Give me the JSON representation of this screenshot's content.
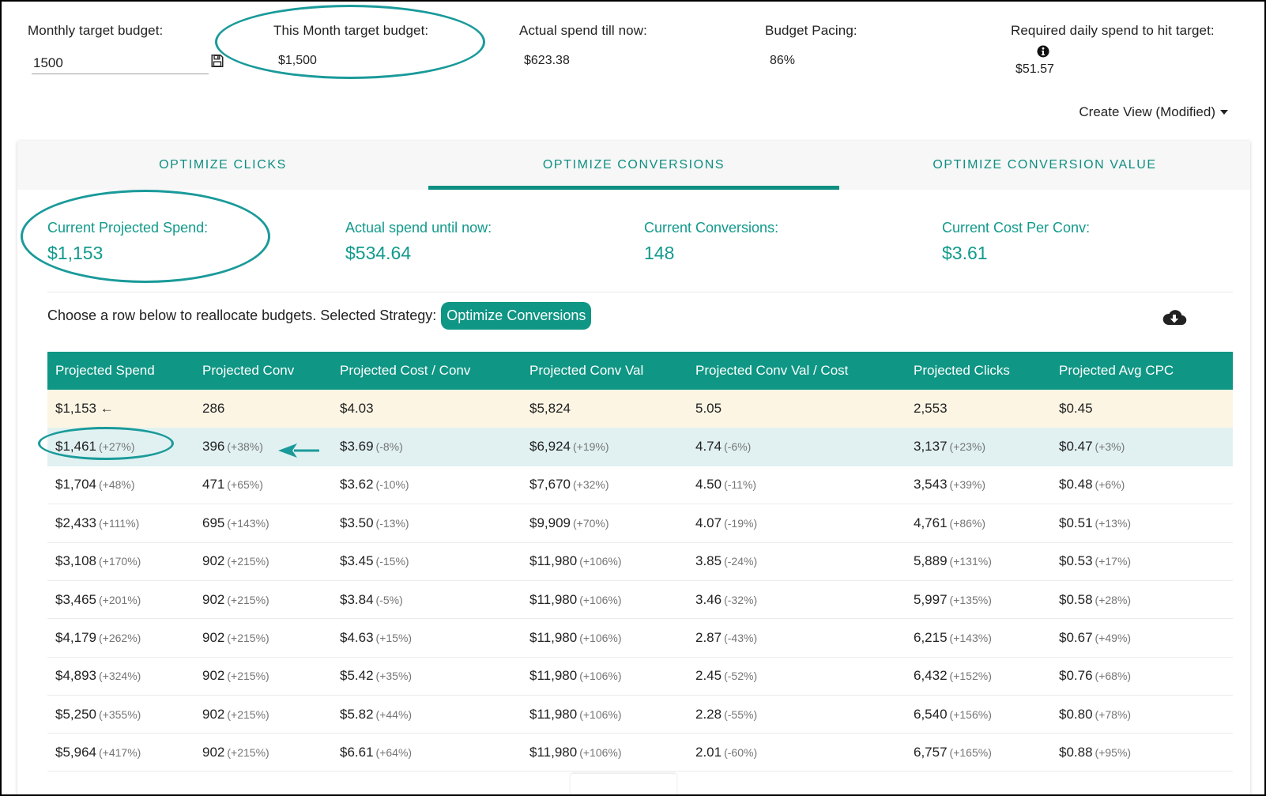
{
  "summary": {
    "monthly_target": {
      "label": "Monthly target budget:",
      "value": "1500"
    },
    "this_month_target": {
      "label": "This Month target budget:",
      "value": "$1,500"
    },
    "actual_spend": {
      "label": "Actual spend till now:",
      "value": "$623.38"
    },
    "budget_pacing": {
      "label": "Budget Pacing:",
      "value": "86%"
    },
    "required_daily": {
      "label": "Required daily spend to hit target:",
      "value": "$51.57"
    },
    "create_view_label": "Create View (Modified)"
  },
  "icons": {
    "save": "save-icon",
    "info": "info-icon",
    "caret": "caret-down-icon",
    "download": "cloud-download-icon",
    "current_marker": "←"
  },
  "tabs": [
    {
      "label": "OPTIMIZE CLICKS",
      "active": false
    },
    {
      "label": "OPTIMIZE CONVERSIONS",
      "active": true
    },
    {
      "label": "OPTIMIZE CONVERSION VALUE",
      "active": false
    }
  ],
  "metrics": [
    {
      "label": "Current Projected Spend:",
      "value": "$1,153"
    },
    {
      "label": "Actual spend until now:",
      "value": "$534.64"
    },
    {
      "label": "Current Conversions:",
      "value": "148"
    },
    {
      "label": "Current Cost Per Conv:",
      "value": "$3.61"
    }
  ],
  "strategy": {
    "text": "Choose a row below to reallocate budgets. Selected Strategy:",
    "selected": "Optimize Conversions"
  },
  "colors": {
    "accent": "#0f9684",
    "current_row": "#fcf5e3",
    "selected_row": "#e1f1f1",
    "annotation": "#1a9a9a"
  },
  "table": {
    "headers": [
      "Projected Spend",
      "Projected Conv",
      "Projected Cost / Conv",
      "Projected Conv Val",
      "Projected Conv Val / Cost",
      "Projected Clicks",
      "Projected Avg CPC"
    ],
    "rows": [
      {
        "state": "current",
        "cells": [
          {
            "v": "$1,153 ←",
            "d": ""
          },
          {
            "v": "286",
            "d": ""
          },
          {
            "v": "$4.03",
            "d": ""
          },
          {
            "v": "$5,824",
            "d": ""
          },
          {
            "v": "5.05",
            "d": ""
          },
          {
            "v": "2,553",
            "d": ""
          },
          {
            "v": "$0.45",
            "d": ""
          }
        ]
      },
      {
        "state": "selected",
        "cells": [
          {
            "v": "$1,461",
            "d": "(+27%)"
          },
          {
            "v": "396",
            "d": "(+38%)"
          },
          {
            "v": "$3.69",
            "d": "(-8%)"
          },
          {
            "v": "$6,924",
            "d": "(+19%)"
          },
          {
            "v": "4.74",
            "d": "(-6%)"
          },
          {
            "v": "3,137",
            "d": "(+23%)"
          },
          {
            "v": "$0.47",
            "d": "(+3%)"
          }
        ]
      },
      {
        "state": "",
        "cells": [
          {
            "v": "$1,704",
            "d": "(+48%)"
          },
          {
            "v": "471",
            "d": "(+65%)"
          },
          {
            "v": "$3.62",
            "d": "(-10%)"
          },
          {
            "v": "$7,670",
            "d": "(+32%)"
          },
          {
            "v": "4.50",
            "d": "(-11%)"
          },
          {
            "v": "3,543",
            "d": "(+39%)"
          },
          {
            "v": "$0.48",
            "d": "(+6%)"
          }
        ]
      },
      {
        "state": "",
        "cells": [
          {
            "v": "$2,433",
            "d": "(+111%)"
          },
          {
            "v": "695",
            "d": "(+143%)"
          },
          {
            "v": "$3.50",
            "d": "(-13%)"
          },
          {
            "v": "$9,909",
            "d": "(+70%)"
          },
          {
            "v": "4.07",
            "d": "(-19%)"
          },
          {
            "v": "4,761",
            "d": "(+86%)"
          },
          {
            "v": "$0.51",
            "d": "(+13%)"
          }
        ]
      },
      {
        "state": "",
        "cells": [
          {
            "v": "$3,108",
            "d": "(+170%)"
          },
          {
            "v": "902",
            "d": "(+215%)"
          },
          {
            "v": "$3.45",
            "d": "(-15%)"
          },
          {
            "v": "$11,980",
            "d": "(+106%)"
          },
          {
            "v": "3.85",
            "d": "(-24%)"
          },
          {
            "v": "5,889",
            "d": "(+131%)"
          },
          {
            "v": "$0.53",
            "d": "(+17%)"
          }
        ]
      },
      {
        "state": "",
        "cells": [
          {
            "v": "$3,465",
            "d": "(+201%)"
          },
          {
            "v": "902",
            "d": "(+215%)"
          },
          {
            "v": "$3.84",
            "d": "(-5%)"
          },
          {
            "v": "$11,980",
            "d": "(+106%)"
          },
          {
            "v": "3.46",
            "d": "(-32%)"
          },
          {
            "v": "5,997",
            "d": "(+135%)"
          },
          {
            "v": "$0.58",
            "d": "(+28%)"
          }
        ]
      },
      {
        "state": "",
        "cells": [
          {
            "v": "$4,179",
            "d": "(+262%)"
          },
          {
            "v": "902",
            "d": "(+215%)"
          },
          {
            "v": "$4.63",
            "d": "(+15%)"
          },
          {
            "v": "$11,980",
            "d": "(+106%)"
          },
          {
            "v": "2.87",
            "d": "(-43%)"
          },
          {
            "v": "6,215",
            "d": "(+143%)"
          },
          {
            "v": "$0.67",
            "d": "(+49%)"
          }
        ]
      },
      {
        "state": "",
        "cells": [
          {
            "v": "$4,893",
            "d": "(+324%)"
          },
          {
            "v": "902",
            "d": "(+215%)"
          },
          {
            "v": "$5.42",
            "d": "(+35%)"
          },
          {
            "v": "$11,980",
            "d": "(+106%)"
          },
          {
            "v": "2.45",
            "d": "(-52%)"
          },
          {
            "v": "6,432",
            "d": "(+152%)"
          },
          {
            "v": "$0.76",
            "d": "(+68%)"
          }
        ]
      },
      {
        "state": "",
        "cells": [
          {
            "v": "$5,250",
            "d": "(+355%)"
          },
          {
            "v": "902",
            "d": "(+215%)"
          },
          {
            "v": "$5.82",
            "d": "(+44%)"
          },
          {
            "v": "$11,980",
            "d": "(+106%)"
          },
          {
            "v": "2.28",
            "d": "(-55%)"
          },
          {
            "v": "6,540",
            "d": "(+156%)"
          },
          {
            "v": "$0.80",
            "d": "(+78%)"
          }
        ]
      },
      {
        "state": "",
        "cells": [
          {
            "v": "$5,964",
            "d": "(+417%)"
          },
          {
            "v": "902",
            "d": "(+215%)"
          },
          {
            "v": "$6.61",
            "d": "(+64%)"
          },
          {
            "v": "$11,980",
            "d": "(+106%)"
          },
          {
            "v": "2.01",
            "d": "(-60%)"
          },
          {
            "v": "6,757",
            "d": "(+165%)"
          },
          {
            "v": "$0.88",
            "d": "(+95%)"
          }
        ]
      }
    ]
  }
}
